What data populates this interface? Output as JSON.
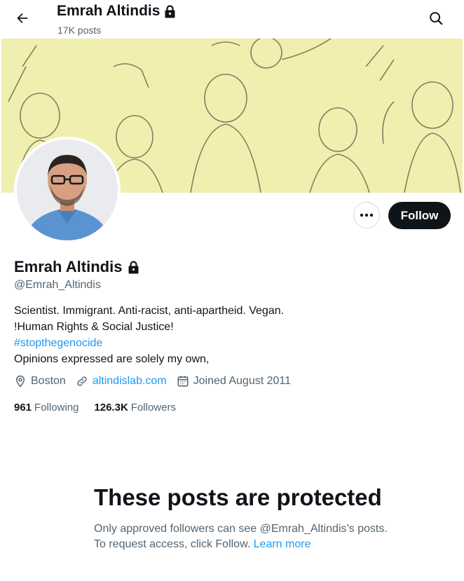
{
  "header": {
    "name": "Emrah Altindis",
    "posts": "17K posts"
  },
  "profile": {
    "name": "Emrah Altindis",
    "handle": "@Emrah_Altindis",
    "follow_label": "Follow",
    "bio_lines": [
      "Scientist. Immigrant. Anti-racist, anti-apartheid. Vegan.",
      "!Human Rights & Social Justice!",
      "#stopthegenocide",
      "Opinions expressed are solely my own,"
    ],
    "location": "Boston",
    "website": "altindislab.com",
    "joined": "Joined August 2011",
    "following_count": "961",
    "following_label": "Following",
    "followers_count": "126.3K",
    "followers_label": "Followers"
  },
  "protected": {
    "title": "These posts are protected",
    "description": "Only approved followers can see @Emrah_Altindis’s posts. To request access, click Follow.",
    "learn_more": "Learn more"
  },
  "colors": {
    "accent": "#1d9bf0",
    "text": "#0f1419",
    "muted": "#536471",
    "banner": "#f1efb0"
  },
  "icons": {
    "back": "arrow-left-icon",
    "search": "search-icon",
    "lock": "lock-icon",
    "more": "more-icon",
    "location": "location-pin-icon",
    "link": "link-icon",
    "calendar": "calendar-icon"
  }
}
